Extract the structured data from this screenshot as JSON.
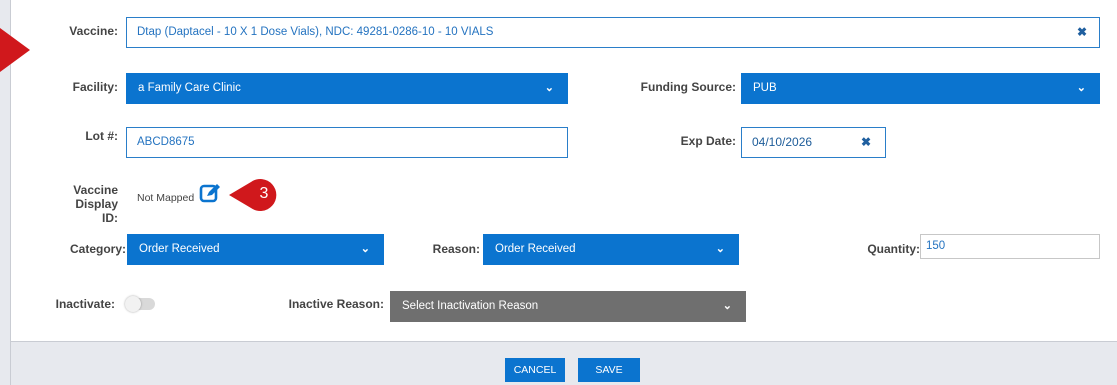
{
  "form": {
    "vaccine": {
      "label": "Vaccine:",
      "value": "Dtap (Daptacel - 10 X 1 Dose Vials), NDC: 49281-0286-10 - 10 VIALS",
      "clear_icon": "times-icon"
    },
    "facility": {
      "label": "Facility:",
      "value": "a Family Care Clinic"
    },
    "funding_source": {
      "label": "Funding Source:",
      "value": "PUB"
    },
    "lot": {
      "label": "Lot #:",
      "value": "ABCD8675"
    },
    "exp_date": {
      "label": "Exp Date:",
      "value": "04/10/2026"
    },
    "display_id": {
      "label_line1": "Vaccine",
      "label_line2": "Display ID:",
      "value": "Not Mapped",
      "edit_icon": "edit-icon"
    },
    "category": {
      "label": "Category:",
      "value": "Order Received"
    },
    "reason": {
      "label": "Reason:",
      "value": "Order Received"
    },
    "quantity": {
      "label": "Quantity:",
      "value": "150"
    },
    "inactivate": {
      "label": "Inactivate:",
      "on": false
    },
    "inactive_reason": {
      "label": "Inactive Reason:",
      "value": "Select Inactivation Reason"
    }
  },
  "callout": {
    "number": "3"
  },
  "buttons": {
    "cancel": "CANCEL",
    "save": "SAVE"
  },
  "colors": {
    "accent": "#0b74cf",
    "callout": "#d0181c",
    "disabled_select": "#6f6f6f"
  }
}
